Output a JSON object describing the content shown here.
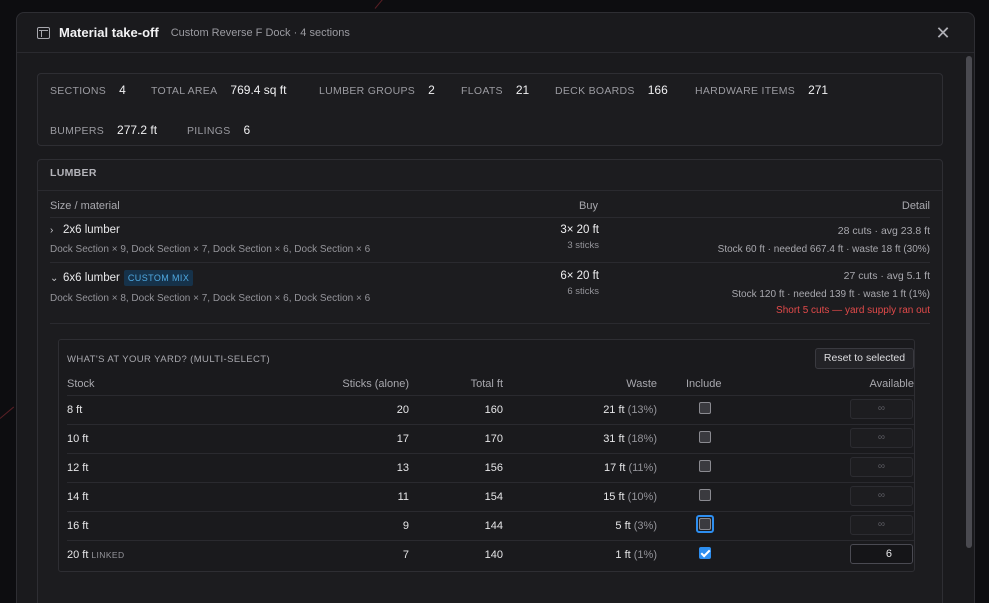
{
  "header": {
    "title": "Material take-off",
    "subtitle": "Custom Reverse F Dock · 4 sections"
  },
  "summary": {
    "sections_label": "SECTIONS",
    "sections": "4",
    "total_area_label": "TOTAL AREA",
    "total_area": "769.4 sq ft",
    "lumber_groups_label": "LUMBER GROUPS",
    "lumber_groups": "2",
    "floats_label": "FLOATS",
    "floats": "21",
    "deck_boards_label": "DECK BOARDS",
    "deck_boards": "166",
    "hardware_items_label": "HARDWARE ITEMS",
    "hardware_items": "271",
    "bumpers_label": "BUMPERS",
    "bumpers": "277.2 ft",
    "pilings_label": "PILINGS",
    "pilings": "6"
  },
  "lumber": {
    "title": "LUMBER",
    "col_size": "Size / material",
    "col_buy": "Buy",
    "col_detail": "Detail",
    "rows": [
      {
        "chevron": "›",
        "name": "2x6 lumber",
        "sections": "Dock Section × 9, Dock Section × 7, Dock Section × 6, Dock Section × 6",
        "buy": "3× 20 ft",
        "buy_sub": "3 sticks",
        "detail1": "28 cuts · avg 23.8 ft",
        "detail2": "Stock 60 ft · needed 667.4 ft · waste 18 ft (30%)"
      },
      {
        "chevron": "⌄",
        "name": "6x6 lumber",
        "badge": "CUSTOM MIX",
        "sections": "Dock Section × 8, Dock Section × 7, Dock Section × 6, Dock Section × 6",
        "buy": "6× 20 ft",
        "buy_sub": "6 sticks",
        "detail1": "27 cuts · avg 5.1 ft",
        "detail2": "Stock 120 ft · needed 139 ft · waste 1 ft (1%)",
        "warning": "Short 5 cuts — yard supply ran out"
      }
    ]
  },
  "yard": {
    "title": "WHAT'S AT YOUR YARD? (MULTI-SELECT)",
    "reset_label": "Reset to selected",
    "col_stock": "Stock",
    "col_sticks": "Sticks (alone)",
    "col_total": "Total ft",
    "col_waste": "Waste",
    "col_include": "Include",
    "col_available": "Available",
    "rows": [
      {
        "stock": "8 ft",
        "linked": "",
        "sticks": "20",
        "total": "160",
        "waste": "21 ft",
        "waste_pct": "(13%)",
        "include": false,
        "available": "∞"
      },
      {
        "stock": "10 ft",
        "linked": "",
        "sticks": "17",
        "total": "170",
        "waste": "31 ft",
        "waste_pct": "(18%)",
        "include": false,
        "available": "∞"
      },
      {
        "stock": "12 ft",
        "linked": "",
        "sticks": "13",
        "total": "156",
        "waste": "17 ft",
        "waste_pct": "(11%)",
        "include": false,
        "available": "∞"
      },
      {
        "stock": "14 ft",
        "linked": "",
        "sticks": "11",
        "total": "154",
        "waste": "15 ft",
        "waste_pct": "(10%)",
        "include": false,
        "available": "∞"
      },
      {
        "stock": "16 ft",
        "linked": "",
        "sticks": "9",
        "total": "144",
        "waste": "5 ft",
        "waste_pct": "(3%)",
        "include": false,
        "available": "∞"
      },
      {
        "stock": "20 ft",
        "linked": "LINKED",
        "sticks": "7",
        "total": "140",
        "waste": "1 ft",
        "waste_pct": "(1%)",
        "include": true,
        "available": "6"
      }
    ]
  },
  "colors": {
    "accent": "#2d8ef0",
    "warning": "#e24a4a",
    "badge_bg": "#16324a",
    "badge_text": "#4fa8e0"
  }
}
